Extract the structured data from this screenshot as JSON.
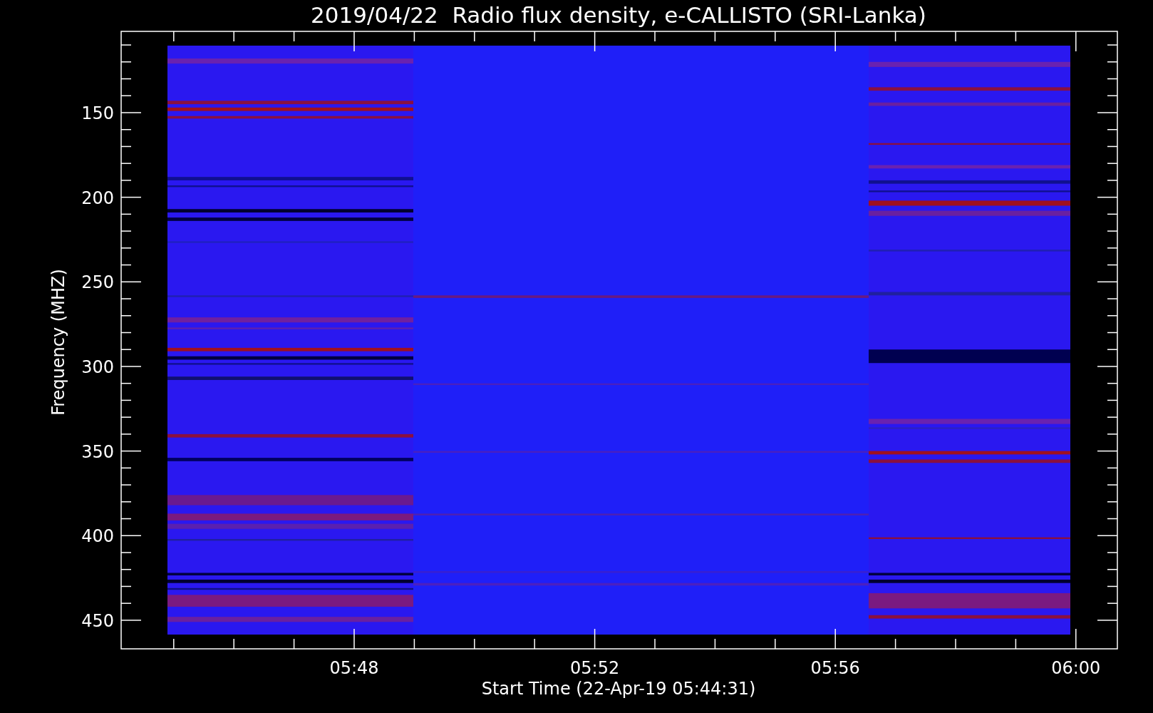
{
  "title": "2019/04/22  Radio flux density, e-CALLISTO (SRI-Lanka)",
  "y_axis": {
    "label": "Frequency (MHZ)",
    "ticks": [
      "150",
      "200",
      "250",
      "300",
      "350",
      "400",
      "450"
    ]
  },
  "x_axis": {
    "label": "Start Time (22-Apr-19 05:44:31)",
    "ticks": [
      "05:48",
      "05:52",
      "05:56",
      "06:00"
    ]
  }
}
